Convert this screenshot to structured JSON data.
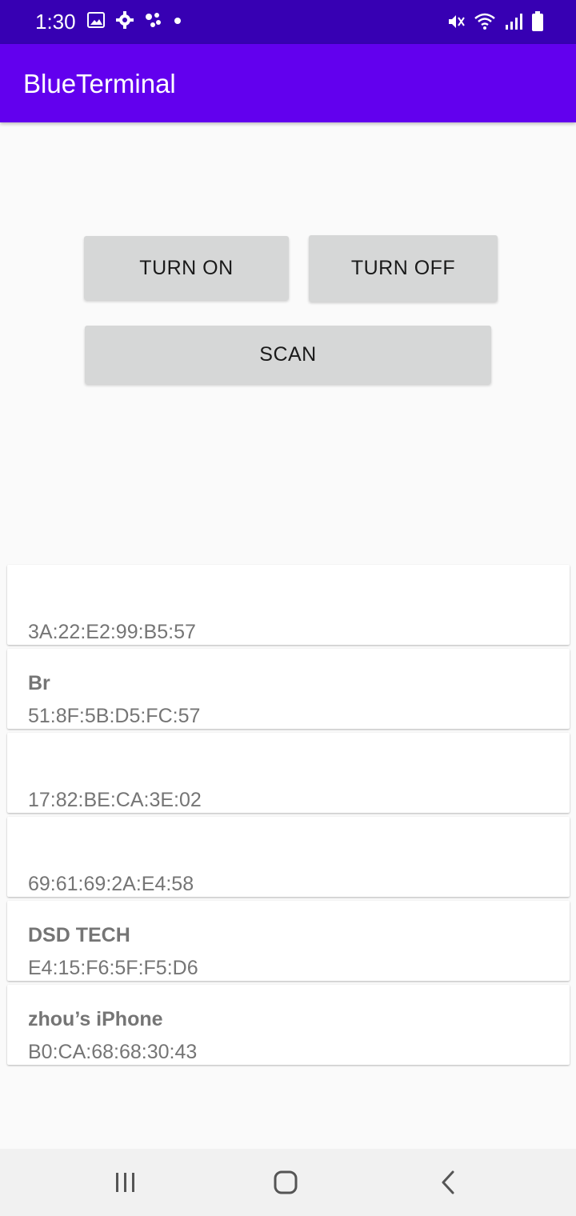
{
  "status": {
    "time": "1:30",
    "icons": [
      "image-icon",
      "gear-icon",
      "assistant-icon",
      "dot-icon",
      "mute-icon",
      "wifi-icon",
      "signal-icon",
      "battery-icon"
    ]
  },
  "app": {
    "title": "BlueTerminal",
    "primary_color": "#6200ee",
    "status_color": "#3700b3"
  },
  "buttons": {
    "turn_on": "TURN ON",
    "turn_off": "TURN OFF",
    "scan": "SCAN"
  },
  "devices": [
    {
      "name": "",
      "address": "3A:22:E2:99:B5:57"
    },
    {
      "name": "Br",
      "address": "51:8F:5B:D5:FC:57"
    },
    {
      "name": "",
      "address": "17:82:BE:CA:3E:02"
    },
    {
      "name": "",
      "address": "69:61:69:2A:E4:58"
    },
    {
      "name": "DSD TECH",
      "address": "E4:15:F6:5F:F5:D6"
    },
    {
      "name": "zhou’s iPhone",
      "address": "B0:CA:68:68:30:43"
    }
  ],
  "nav": {
    "icons": [
      "recent-apps-icon",
      "home-icon",
      "back-icon"
    ]
  }
}
